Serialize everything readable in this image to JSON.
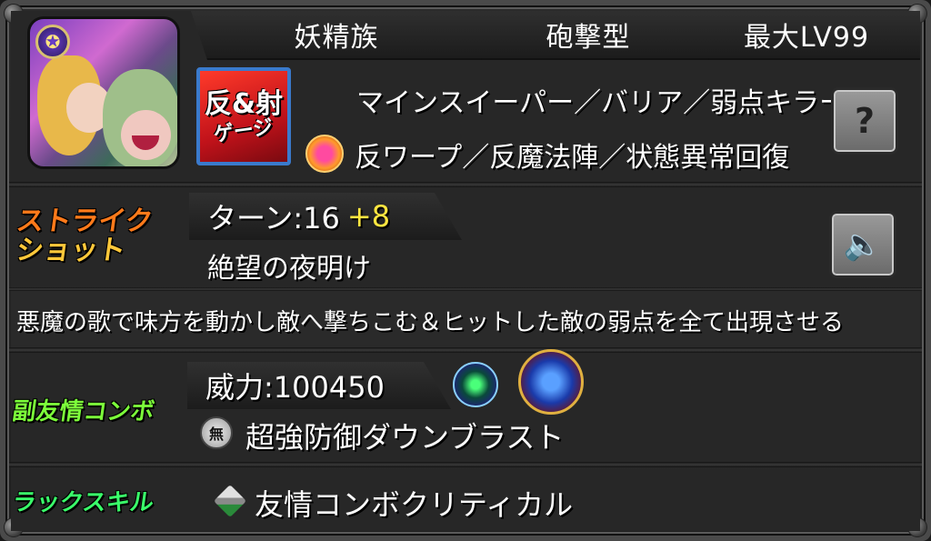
{
  "header": {
    "tribe": "妖精族",
    "type": "砲撃型",
    "max_level": "最大LV99"
  },
  "portrait": {
    "badge": "✪"
  },
  "gauge": {
    "line1": "反&射",
    "line2": "ゲージ"
  },
  "abilities": {
    "line1": "マインスイーパー／バリア／弱点キラー",
    "line2": "反ワープ／反魔法陣／状態異常回復"
  },
  "strike_shot": {
    "label_line1": "ストライク",
    "label_line2": "ショット",
    "turns_label": "ターン:16",
    "turns_bonus": "+8",
    "name": "絶望の夜明け",
    "description": "悪魔の歌で味方を動かし敵へ撃ちこむ＆ヒットした敵の弱点を全て出現させる"
  },
  "sub_friendship": {
    "label": "副友情コンボ",
    "power": "威力:100450",
    "badge": "無",
    "name": "超強防御ダウンブラスト"
  },
  "luck_skill": {
    "label": "ラックスキル",
    "name": "友情コンボクリティカル"
  },
  "icons": {
    "help": "?",
    "speaker": "🔈"
  },
  "colors": {
    "strike_label": "#ff7a1a",
    "sub_label": "#7cff3a",
    "luck_label": "#3aff6a",
    "turn_bonus": "#ffe640"
  }
}
